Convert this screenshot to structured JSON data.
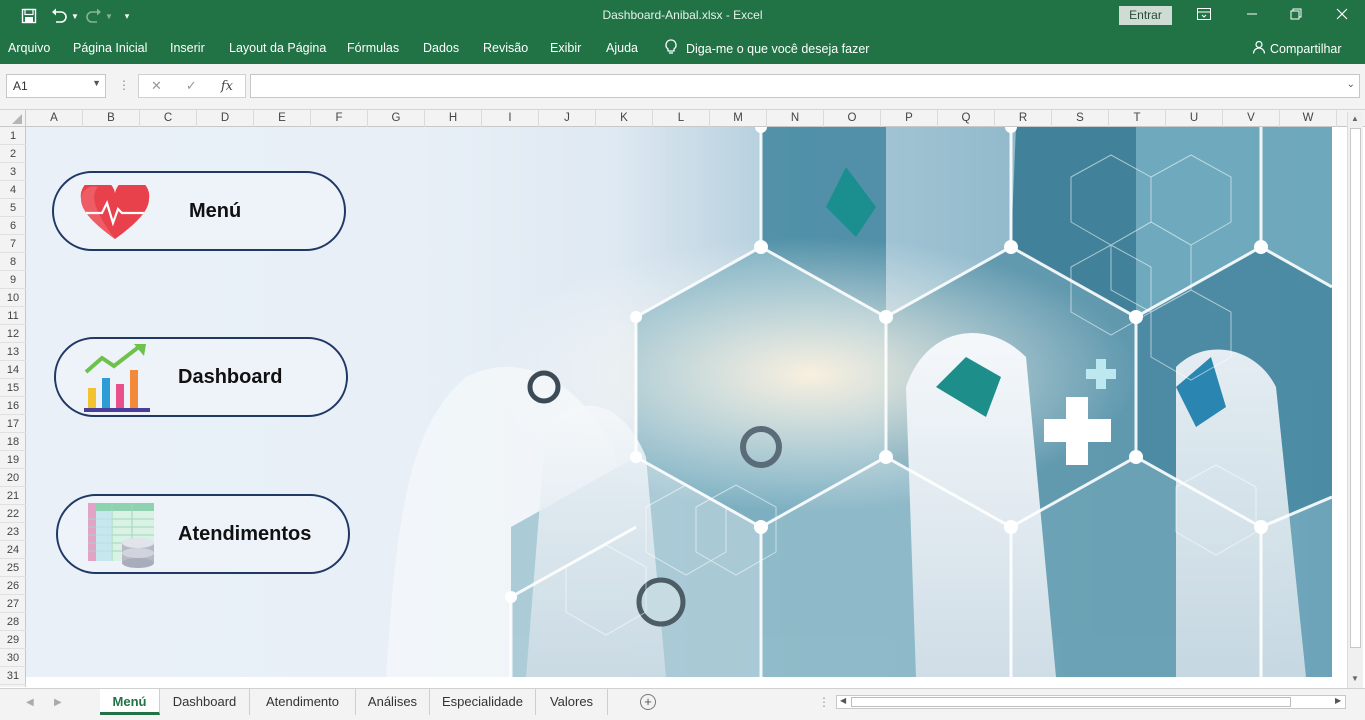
{
  "window": {
    "title": "Dashboard-Anibal.xlsx  -  Excel",
    "signin_label": "Entrar"
  },
  "quick_access": {
    "save_icon": "save-icon",
    "undo_icon": "undo-icon",
    "redo_icon": "redo-icon",
    "customize_icon": "customize-qat-icon"
  },
  "menu": {
    "items": [
      "Arquivo",
      "Página Inicial",
      "Inserir",
      "Layout da Página",
      "Fórmulas",
      "Dados",
      "Revisão",
      "Exibir",
      "Ajuda"
    ],
    "tell_me": "Diga-me o que você deseja fazer",
    "share": "Compartilhar"
  },
  "formula_bar": {
    "name_box": "A1",
    "formula": "",
    "fx_label": "fx"
  },
  "columns": [
    "A",
    "B",
    "C",
    "D",
    "E",
    "F",
    "G",
    "H",
    "I",
    "J",
    "K",
    "L",
    "M",
    "N",
    "O",
    "P",
    "Q",
    "R",
    "S",
    "T",
    "U",
    "V",
    "W"
  ],
  "rows": [
    "1",
    "2",
    "3",
    "4",
    "5",
    "6",
    "7",
    "8",
    "9",
    "10",
    "11",
    "12",
    "13",
    "14",
    "15",
    "16",
    "17",
    "18",
    "19",
    "20",
    "21",
    "22",
    "23",
    "24",
    "25",
    "26",
    "27",
    "28",
    "29",
    "30",
    "31"
  ],
  "nav_buttons": [
    {
      "label": "Menú",
      "icon": "heart-pulse-icon"
    },
    {
      "label": "Dashboard",
      "icon": "bar-chart-growth-icon"
    },
    {
      "label": "Atendimentos",
      "icon": "spreadsheet-database-icon"
    }
  ],
  "sheet_tabs": [
    "Menú",
    "Dashboard",
    "Atendimento",
    "Análises",
    "Especialidade",
    "Valores"
  ],
  "active_tab": "Menú",
  "colors": {
    "excel_green": "#217346",
    "button_border": "#1f3864",
    "heart_red": "#e8414b"
  }
}
